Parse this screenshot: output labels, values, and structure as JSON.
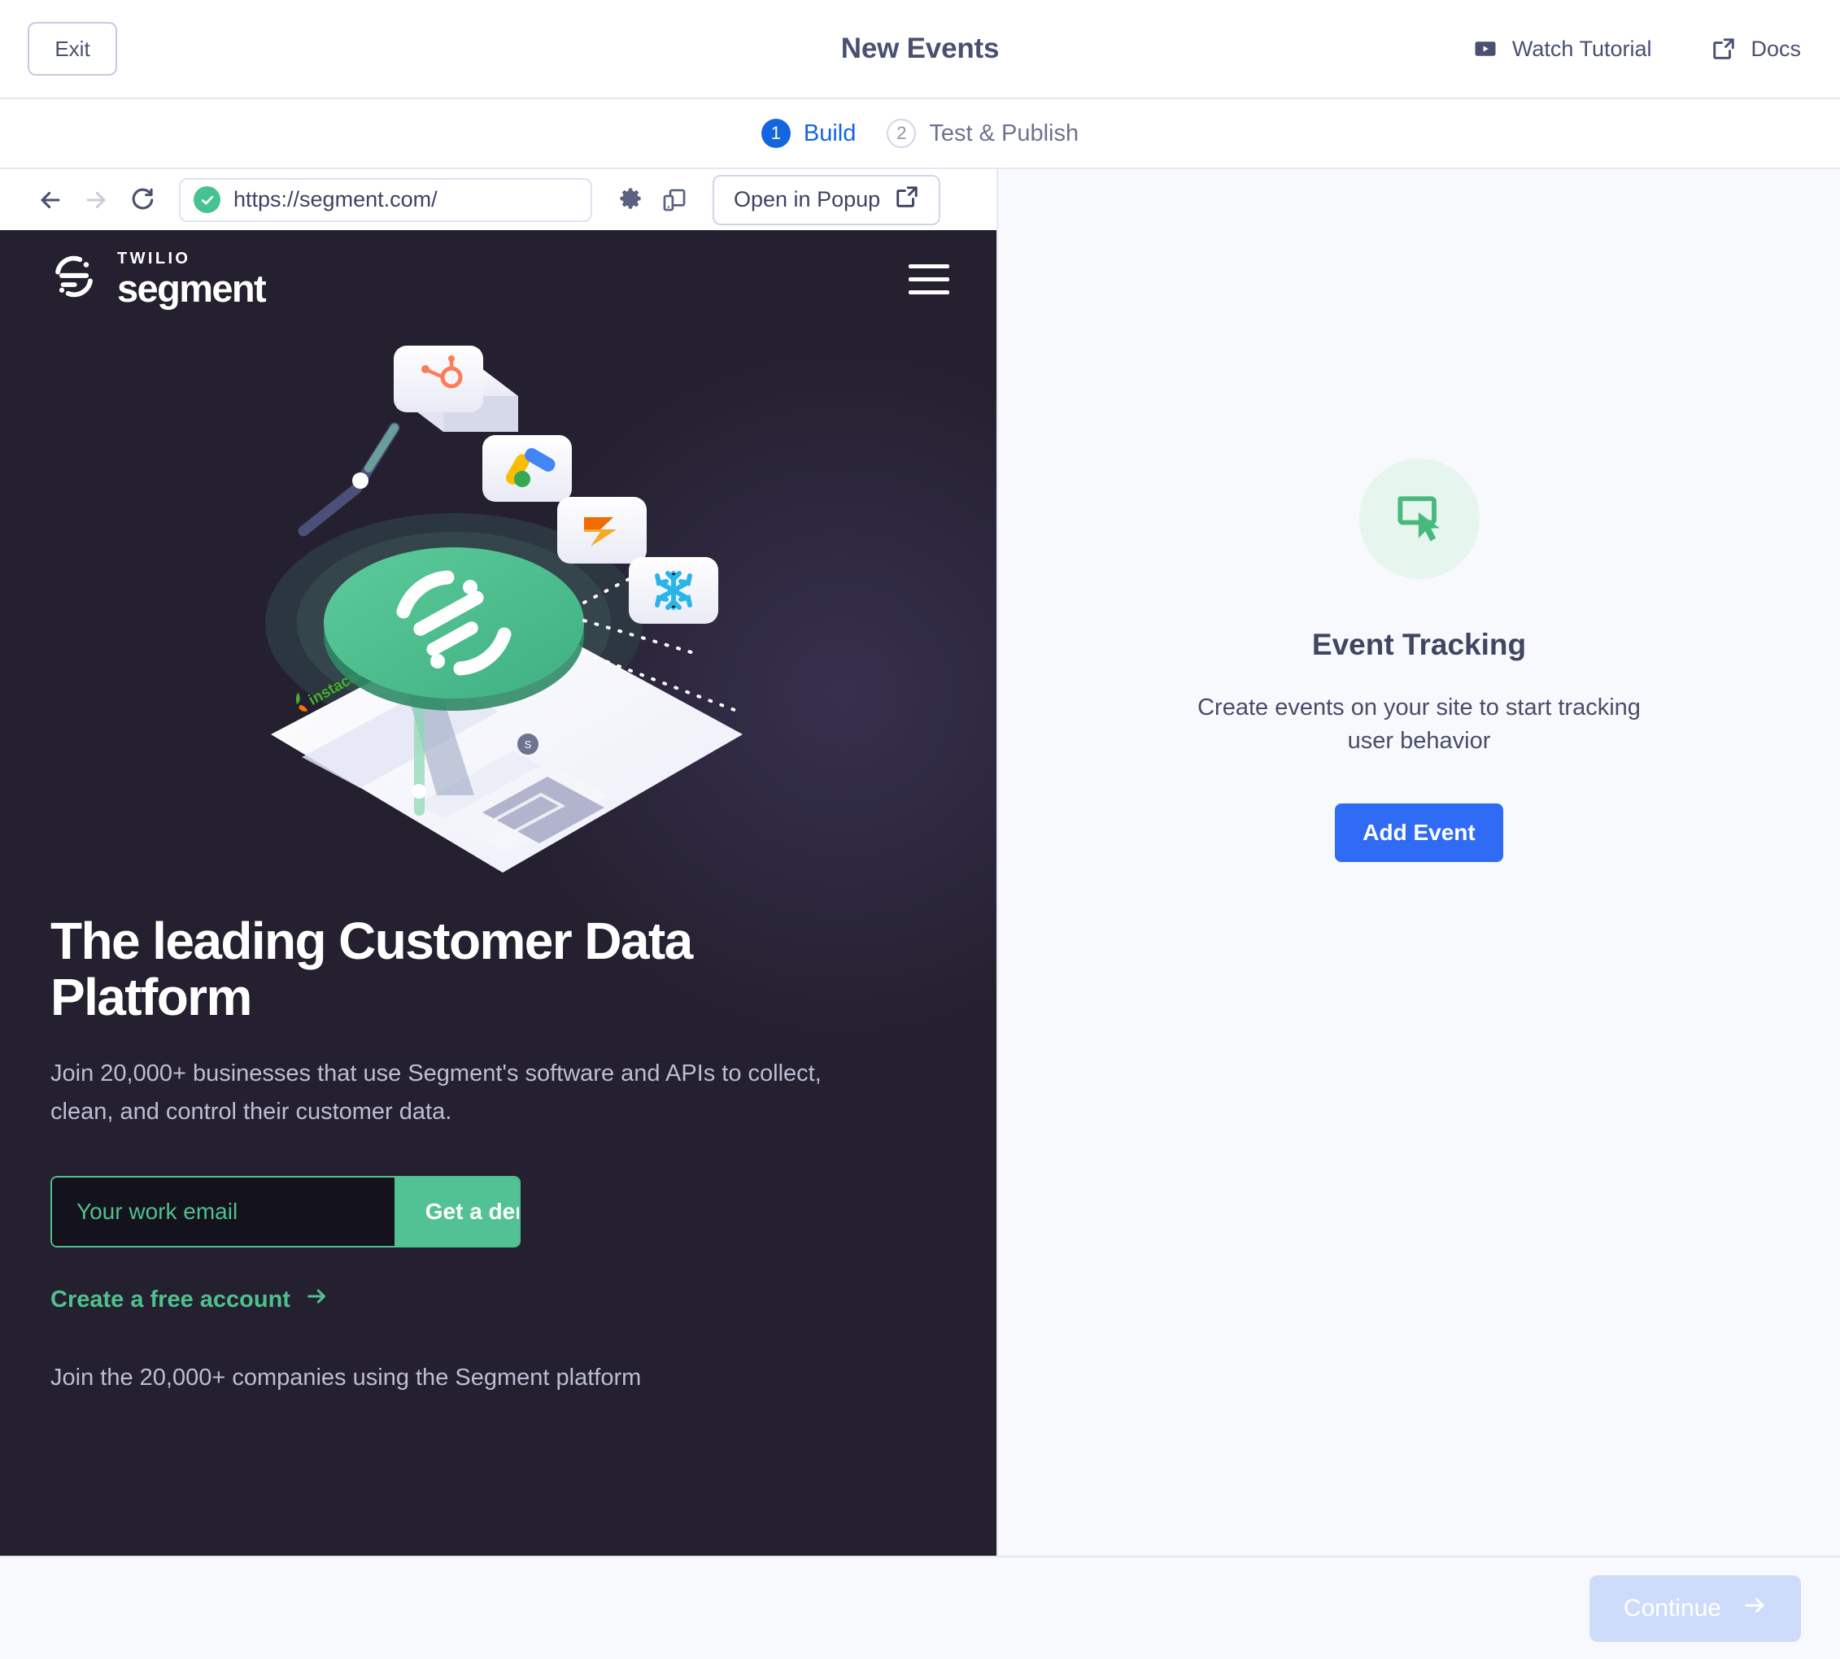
{
  "header": {
    "exit_label": "Exit",
    "title": "New Events",
    "watch_tutorial_label": "Watch Tutorial",
    "docs_label": "Docs"
  },
  "stepper": {
    "steps": [
      {
        "num": "1",
        "label": "Build",
        "state": "active"
      },
      {
        "num": "2",
        "label": "Test & Publish",
        "state": "inactive"
      }
    ]
  },
  "browser": {
    "url": "https://segment.com/",
    "popup_label": "Open in Popup",
    "back_icon": "arrow-left-icon",
    "forward_icon": "arrow-right-icon",
    "reload_icon": "reload-icon",
    "settings_icon": "gear-icon",
    "devices_icon": "responsive-devices-icon",
    "secure_icon": "secure-check-icon"
  },
  "site": {
    "brand_top": "TWILIO",
    "brand_name": "segment",
    "headline": "The leading Customer Data Platform",
    "subhead": "Join 20,000+ businesses that use Segment's software and APIs to collect, clean, and control their customer data.",
    "email_placeholder": "Your work email",
    "email_value": "",
    "demo_label": "Get a demo",
    "free_account_label": "Create a free account",
    "bottom_line": "Join the 20,000+ companies using the Segment platform"
  },
  "right_panel": {
    "icon": "cursor-click-icon",
    "title": "Event Tracking",
    "description": "Create events on your site to start tracking user behavior",
    "add_event_label": "Add Event"
  },
  "footer": {
    "continue_label": "Continue"
  },
  "colors": {
    "accent_blue": "#2f6bf5",
    "step_blue": "#1565e0",
    "segment_green": "#52c294",
    "site_dark": "#24202f",
    "panel_bg": "#f8f9fd",
    "text_dark": "#4a5070",
    "continue_disabled": "#cedcfc"
  }
}
